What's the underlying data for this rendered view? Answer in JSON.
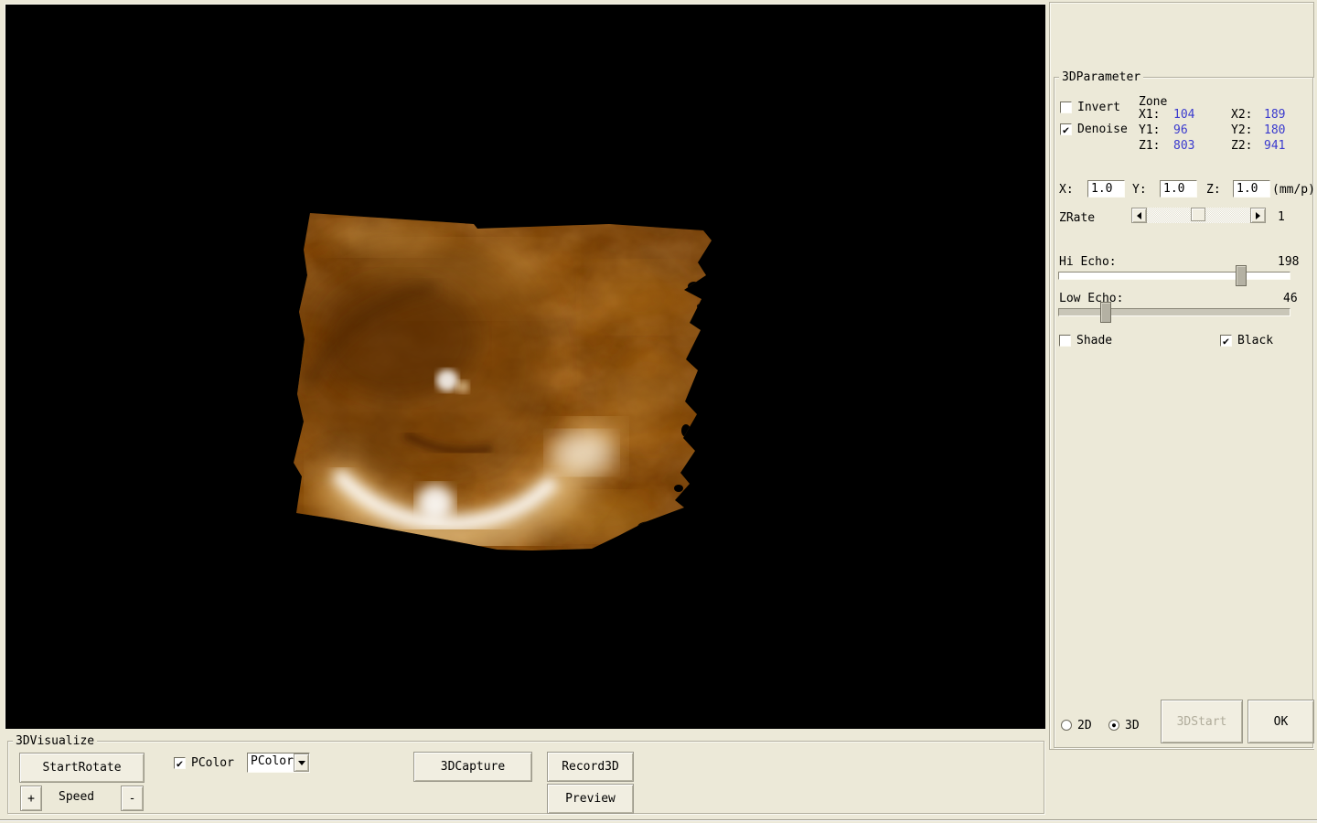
{
  "window": {
    "background": "#ece9d8",
    "value_blue": "#3a3ace"
  },
  "viewport": {
    "description": "3D ultrasound volume render of fetal scan",
    "bg": "#000000",
    "volume_colors": {
      "base": "#8f5009",
      "dark": "#5c2e03",
      "glow": "#ffdf9f",
      "bright": "#ffffff"
    }
  },
  "parameter_panel": {
    "title": "3DParameter",
    "invert": {
      "label": "Invert",
      "glyph": ""
    },
    "denoise": {
      "label": "Denoise",
      "glyph": "✔"
    },
    "zone": {
      "title": "Zone",
      "rows": [
        {
          "l1": "X1:",
          "v1": "104",
          "l2": "X2:",
          "v2": "189"
        },
        {
          "l1": "Y1:",
          "v1": "96",
          "l2": "Y2:",
          "v2": "180"
        },
        {
          "l1": "Z1:",
          "v1": "803",
          "l2": "Z2:",
          "v2": "941"
        }
      ]
    },
    "scale": {
      "x_label": "X:",
      "x_value": "1.0",
      "y_label": "Y:",
      "y_value": "1.0",
      "z_label": "Z:",
      "z_value": "1.0",
      "unit": "(mm/p)"
    },
    "zrate": {
      "label": "ZRate",
      "value": "1"
    },
    "hi_echo": {
      "label": "Hi Echo:",
      "value": "198"
    },
    "low_echo": {
      "label": "Low Echo:",
      "value": "46"
    },
    "shade": {
      "label": "Shade",
      "glyph": ""
    },
    "black": {
      "label": "Black",
      "glyph": "✔"
    },
    "mode_2d": {
      "label": "2D",
      "glyph": ""
    },
    "mode_3d": {
      "label": "3D",
      "glyph": "●"
    },
    "buttons": {
      "start3d": "3DStart",
      "ok": "OK"
    }
  },
  "visualize_panel": {
    "title": "3DVisualize",
    "buttons": {
      "start_rotate": "StartRotate",
      "speed_plus": "+",
      "speed_minus": "-",
      "capture": "3DCapture",
      "record": "Record3D",
      "preview": "Preview"
    },
    "speed_label": "Speed",
    "pcolor": {
      "label": "PColor",
      "glyph": "✔"
    },
    "pcolor_dropdown": {
      "value": "PColor"
    }
  }
}
